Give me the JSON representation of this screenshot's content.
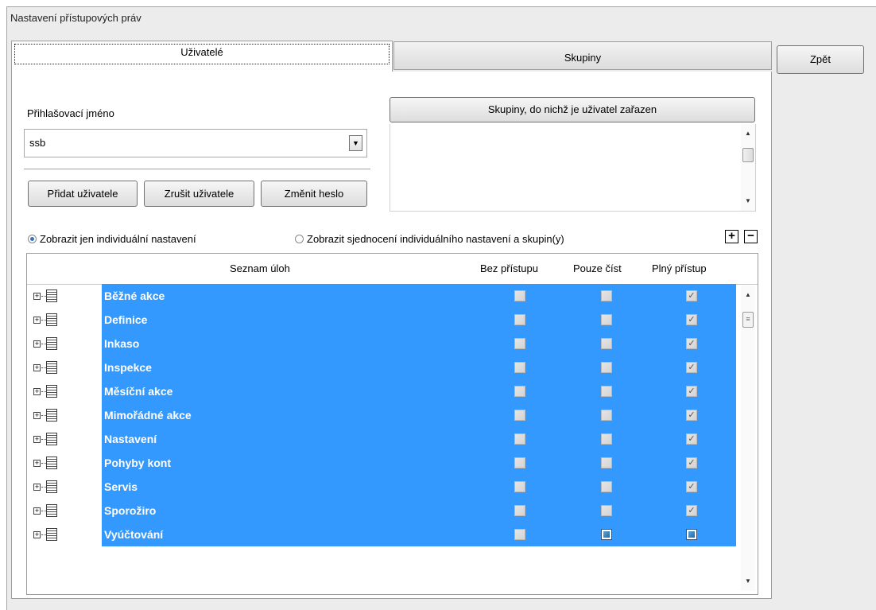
{
  "window": {
    "title": "Nastavení přístupových práv"
  },
  "tabs": [
    {
      "label": "Uživatelé",
      "active": true
    },
    {
      "label": "Skupiny",
      "active": false
    }
  ],
  "back_button": "Zpět",
  "user": {
    "login_label": "Přihlašovací jméno",
    "login_value": "ssb",
    "add_button": "Přidat uživatele",
    "delete_button": "Zrušit uživatele",
    "password_button": "Změnit heslo"
  },
  "groups": {
    "header_button": "Skupiny, do nichž je uživatel zařazen"
  },
  "view_options": [
    {
      "label": "Zobrazit jen individuální nastavení",
      "selected": true
    },
    {
      "label": "Zobrazit sjednocení individuálního nastavení a skupin(y)",
      "selected": false
    }
  ],
  "expand_all": "+",
  "collapse_all": "−",
  "grid": {
    "columns": [
      "Seznam úloh",
      "Bez přístupu",
      "Pouze číst",
      "Plný přístup"
    ],
    "rows": [
      {
        "name": "Běžné akce",
        "bez": "off",
        "cist": "off",
        "plny": "on"
      },
      {
        "name": "Definice",
        "bez": "off",
        "cist": "off",
        "plny": "on"
      },
      {
        "name": "Inkaso",
        "bez": "off",
        "cist": "off",
        "plny": "on"
      },
      {
        "name": "Inspekce",
        "bez": "off",
        "cist": "off",
        "plny": "on"
      },
      {
        "name": "Měsíční akce",
        "bez": "off",
        "cist": "off",
        "plny": "on"
      },
      {
        "name": "Mimořádné akce",
        "bez": "off",
        "cist": "off",
        "plny": "on"
      },
      {
        "name": "Nastavení",
        "bez": "off",
        "cist": "off",
        "plny": "on"
      },
      {
        "name": "Pohyby kont",
        "bez": "off",
        "cist": "off",
        "plny": "on"
      },
      {
        "name": "Servis",
        "bez": "off",
        "cist": "off",
        "plny": "on"
      },
      {
        "name": "Sporožiro",
        "bez": "off",
        "cist": "off",
        "plny": "on"
      },
      {
        "name": "Vyúčtování",
        "bez": "off",
        "cist": "mixed",
        "plny": "mixed"
      }
    ]
  },
  "colors": {
    "selection": "#3399ff",
    "window_bg": "#ececec"
  }
}
